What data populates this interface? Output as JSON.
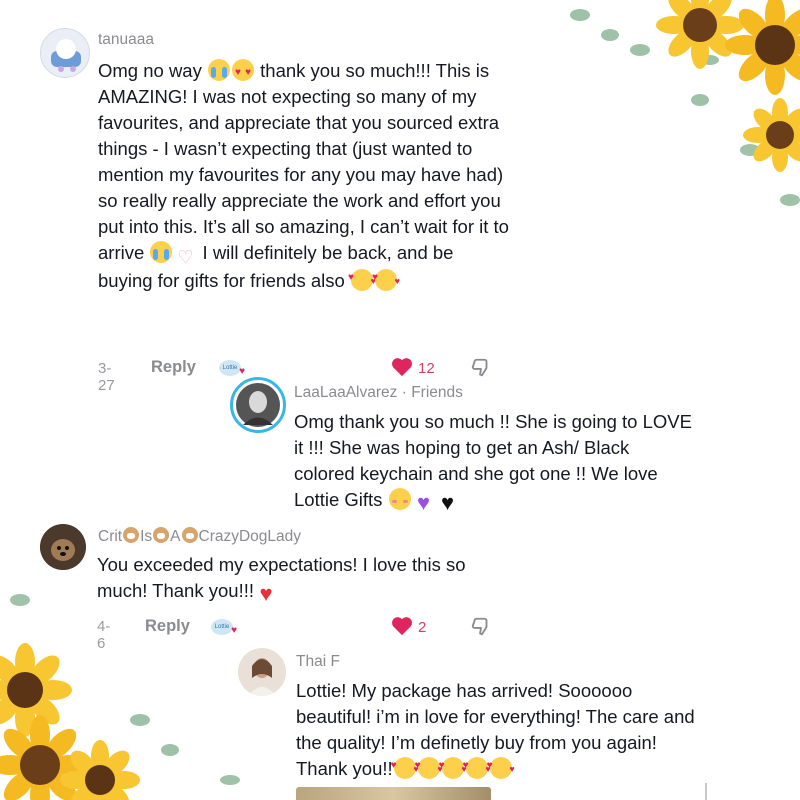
{
  "comments": [
    {
      "username": "tanuaaa",
      "text_parts": [
        "Omg no way ",
        " thank you so much!!! This is AMAZING! I was not expecting so many of my favourites, and appreciate that you sourced extra things - I wasn’t expecting that (just wanted to mention my favourites for any you may have had) so really really appreciate the work and effort you put into this. It’s all so amazing, I can’t wait for it to arrive ",
        " I will definitely be back, and be buying for gifts for friends also "
      ],
      "date": "3-27",
      "reply_label": "Reply",
      "badge_label": "Lottie",
      "like_count": "12"
    },
    {
      "username": "LaaLaaAlvarez",
      "username_suffix": " · Friends",
      "text": "Omg thank you so much !! She is going to LOVE it !!! She was hoping to get an Ash/ Black colored keychain and she got one !! We love Lottie Gifts "
    },
    {
      "username_parts": [
        "Crit",
        "Is",
        "A",
        "CrazyDogLady"
      ],
      "text": "You exceeded my expectations! I love this so much! Thank you!!!",
      "date": "4-6",
      "reply_label": "Reply",
      "badge_label": "Lottie",
      "like_count": "2"
    },
    {
      "username": "Thai F",
      "text": "Lottie! My package has arrived! Soooooo beautiful! i’m in love for everything! The care and the quality! I’m definetly buy from you again! Thank you!!"
    }
  ],
  "icons": {
    "like": "heart-filled-icon",
    "dislike": "thumbs-down-icon"
  },
  "colors": {
    "like_red": "#e0245e",
    "muted": "#8a8b91",
    "text": "#161823"
  }
}
